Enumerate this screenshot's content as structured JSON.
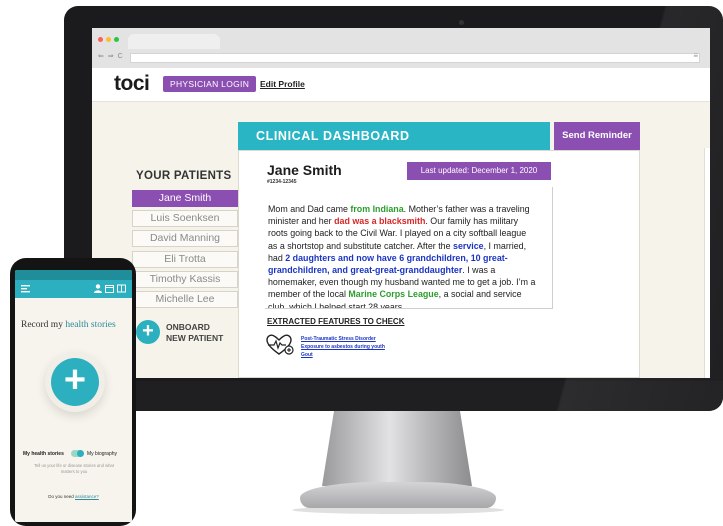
{
  "browser": {
    "nav_glyphs": "⇐ ⇒ C",
    "menu_glyph": "≡"
  },
  "header": {
    "logo": "toci",
    "physician_login": "PHYSICIAN LOGIN",
    "edit_profile": "Edit Profile"
  },
  "patients": {
    "heading": "YOUR PATIENTS",
    "items": [
      {
        "name": "Jane Smith",
        "active": true
      },
      {
        "name": "Luis Soenksen",
        "active": false
      },
      {
        "name": "David Manning",
        "active": false
      },
      {
        "name": "Eli Trotta",
        "active": false
      },
      {
        "name": "Timothy Kassis",
        "active": false
      },
      {
        "name": "Michelle Lee",
        "active": false
      }
    ],
    "onboard_line1": "ONBOARD",
    "onboard_line2": "NEW PATIENT"
  },
  "dashboard": {
    "title": "CLINICAL DASHBOARD",
    "send_reminder": "Send Reminder",
    "patient_name": "Jane Smith",
    "patient_id": "#1234-12345",
    "last_updated": "Last updated: December 1, 2020",
    "story": [
      {
        "t": "Mom and Dad came ",
        "s": ""
      },
      {
        "t": "from Indiana",
        "s": "g"
      },
      {
        "t": ". Mother’s father was a traveling minister and her ",
        "s": ""
      },
      {
        "t": "dad was a blacksmith",
        "s": "r"
      },
      {
        "t": ". Our family has military roots going back to the Civil War. I played on a city softball league as a shortstop and substitute catcher. After the ",
        "s": ""
      },
      {
        "t": "service",
        "s": "b"
      },
      {
        "t": ", I married, had ",
        "s": ""
      },
      {
        "t": "2 daughters and now have 6 grandchildren, 10 great-grandchildren, and great-great-granddaughter",
        "s": "b"
      },
      {
        "t": ". I was a homemaker, even though my husband wanted me to get a job. I’m a member of the local ",
        "s": ""
      },
      {
        "t": "Marine Corps League",
        "s": "g"
      },
      {
        "t": ", a social and service club, which I helped start 28 years",
        "s": ""
      }
    ],
    "features_heading": "EXTRACTED FEATURES TO CHECK",
    "features": [
      "Post-Traumatic Stress Disorder",
      "Exposure to asbestos during youth",
      "Gout"
    ]
  },
  "phone": {
    "record_prefix": "Record my ",
    "record_highlight": "health stories",
    "toggle_left": "My health stories",
    "toggle_right": "My biography",
    "subtitle": "Tell us your life or disease stories and what matters to you",
    "need_prefix": "Do you need ",
    "need_link": "assistance?"
  },
  "colors": {
    "purple": "#8b4fb1",
    "teal": "#2ab5c4",
    "green": "#2c9d2c",
    "red": "#d62626",
    "blue": "#1b35c2"
  }
}
